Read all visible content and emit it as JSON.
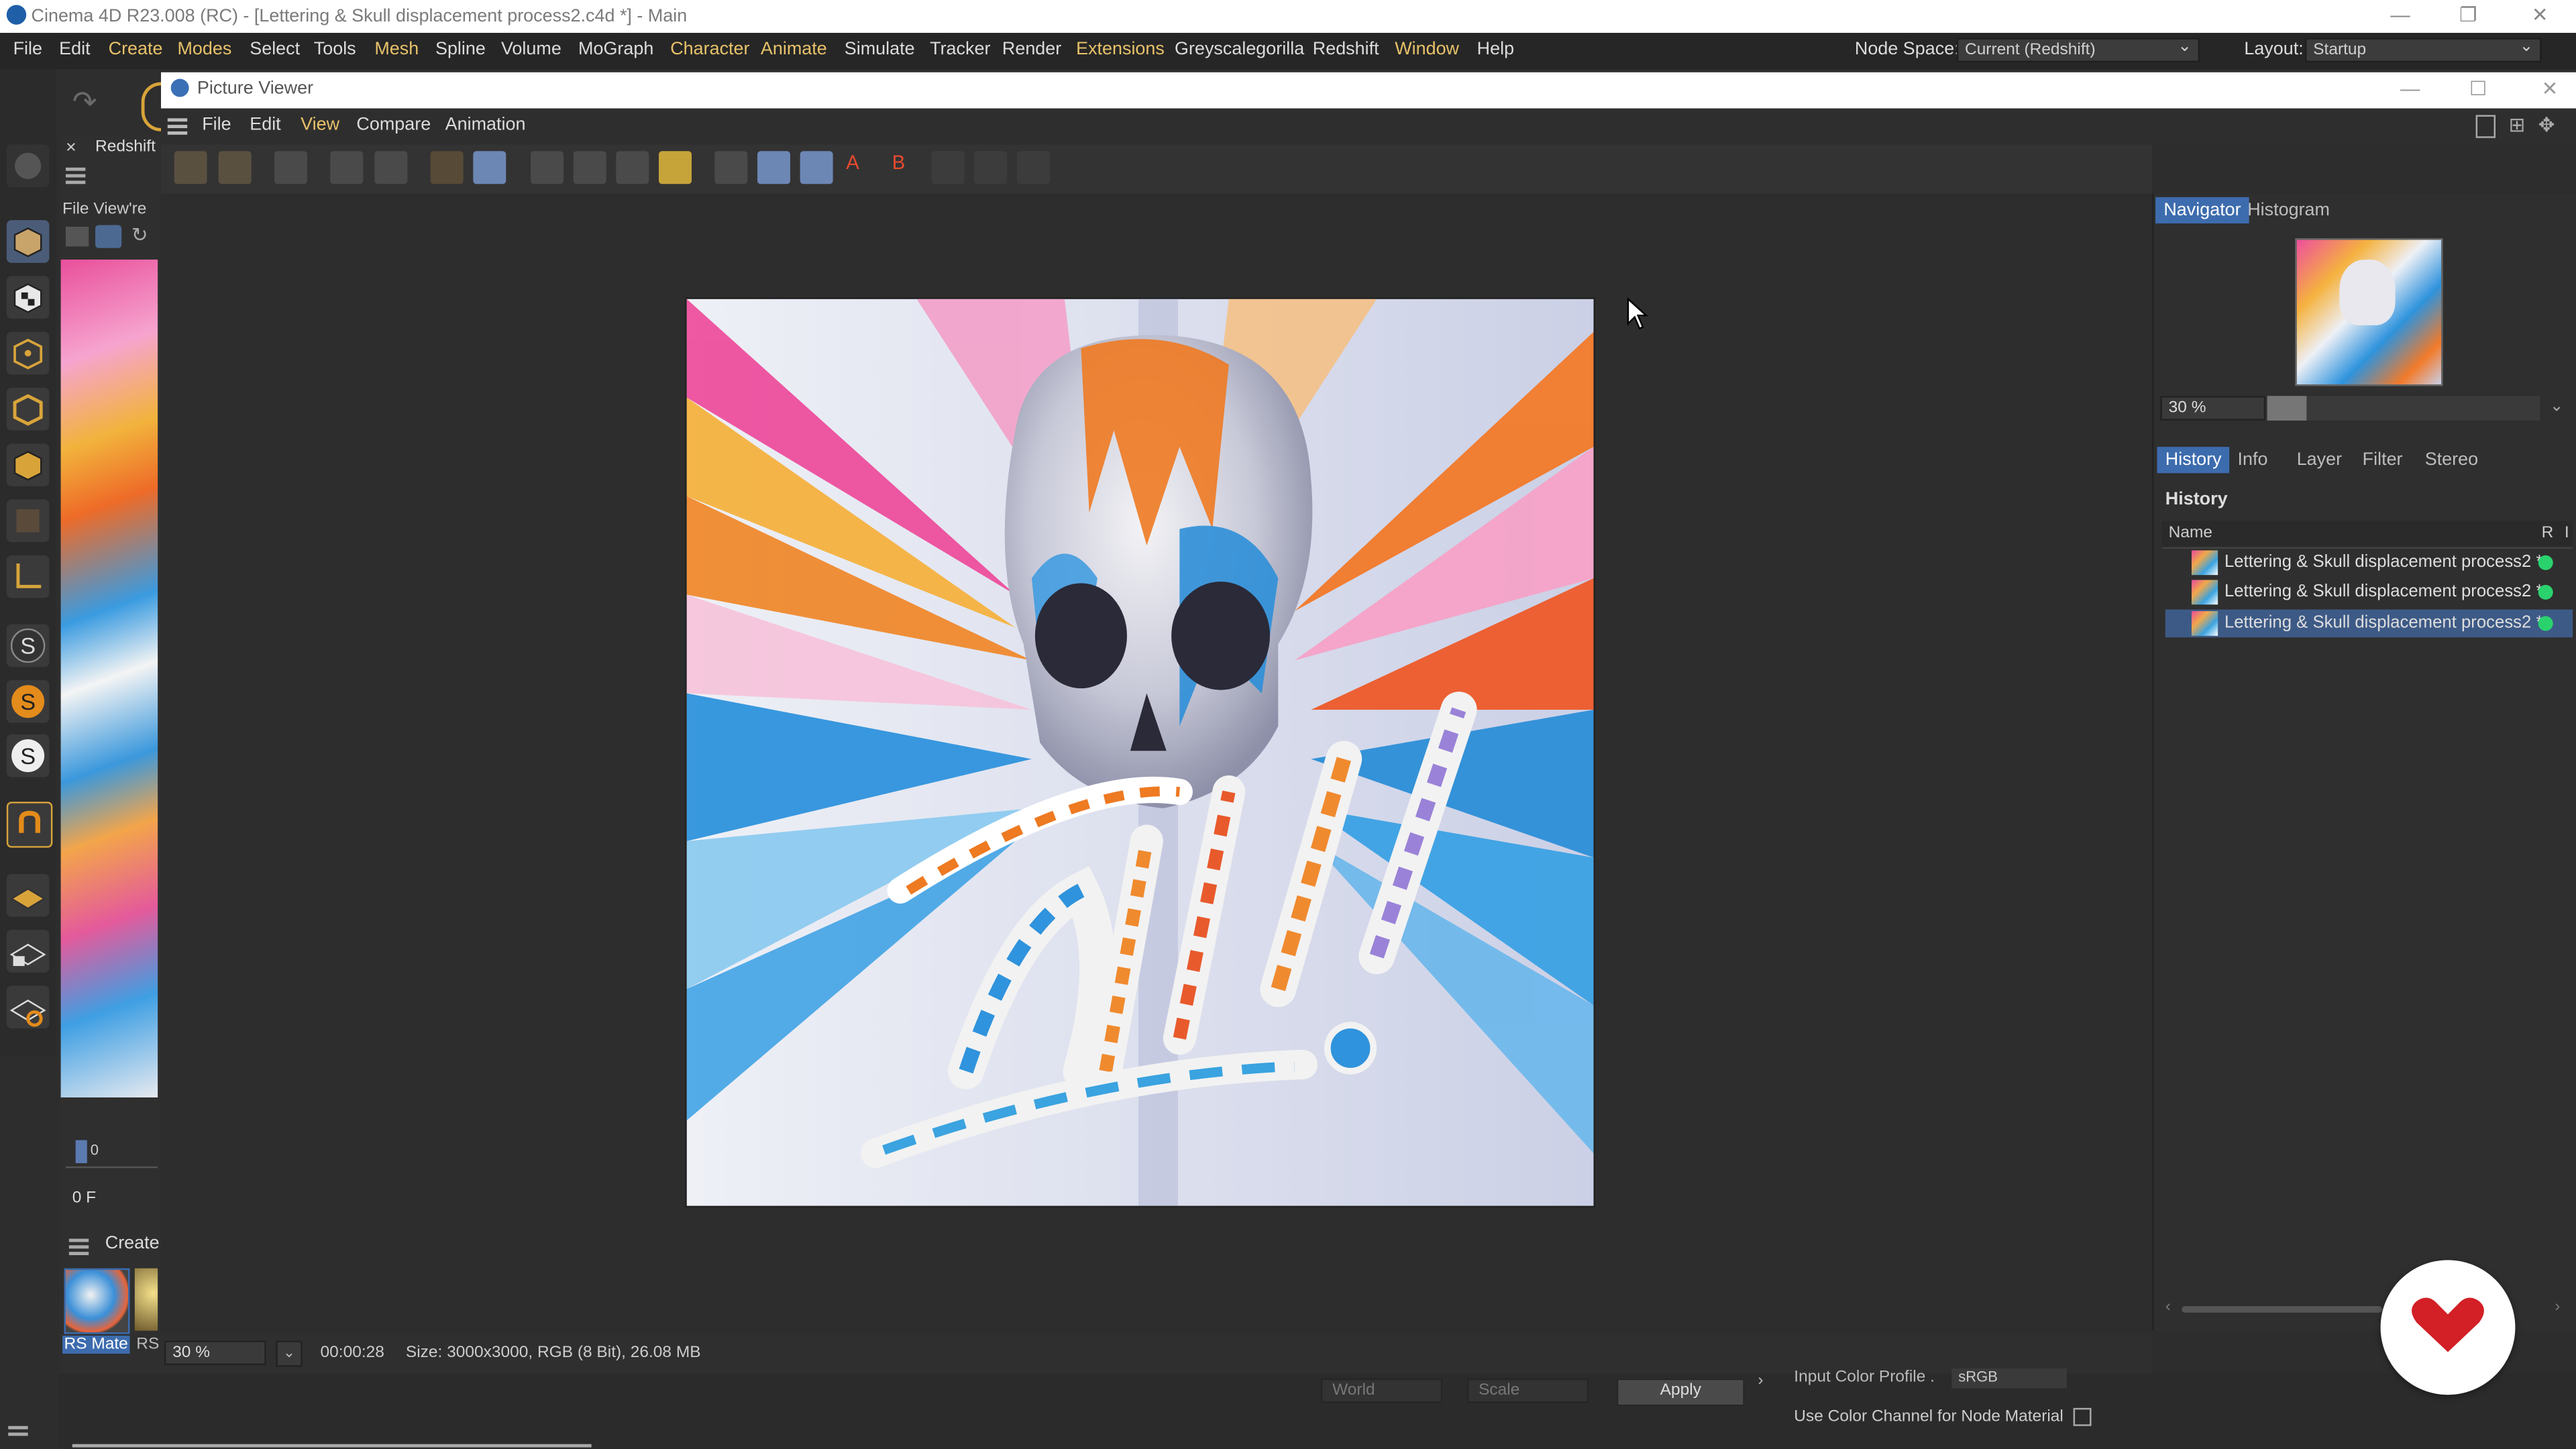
{
  "window": {
    "title": "Cinema 4D R23.008 (RC) - [Lettering & Skull displacement process2.c4d *] - Main",
    "minimize": "—",
    "restore": "❐",
    "close": "✕"
  },
  "menubar": {
    "items": [
      "File",
      "Edit",
      "Create",
      "Modes",
      "Select",
      "Tools",
      "Mesh",
      "Spline",
      "Volume",
      "MoGraph",
      "Character",
      "Animate",
      "Simulate",
      "Tracker",
      "Render",
      "Extensions",
      "Greyscalegorilla",
      "Redshift",
      "Window",
      "Help"
    ],
    "node_space_label": "Node Space:",
    "node_space_value": "Current (Redshift)",
    "layout_label": "Layout:",
    "layout_value": "Startup"
  },
  "left_panel": {
    "redshift_tab": "Redshift",
    "file_view": "File View're",
    "frame_value": "0",
    "frame_field": "0 F",
    "create_label": "Create",
    "material_label": "RS Mate",
    "material_label2": "RS"
  },
  "picture_viewer": {
    "title": "Picture Viewer",
    "menu": [
      "File",
      "Edit",
      "View",
      "Compare",
      "Animation"
    ],
    "zoom": "30 %",
    "time": "00:00:28",
    "size_info": "Size: 3000x3000, RGB (8 Bit), 26.08 MB"
  },
  "navigator": {
    "tabs": [
      "Navigator",
      "Histogram"
    ],
    "zoom": "30 %"
  },
  "history_panel": {
    "tabs": [
      "History",
      "Info",
      "Layer",
      "Filter",
      "Stereo"
    ],
    "heading": "History",
    "col_name": "Name",
    "col_r": "R",
    "col_f": "I",
    "rows": [
      {
        "label": "Lettering & Skull displacement process2 *"
      },
      {
        "label": "Lettering & Skull displacement process2 *"
      },
      {
        "label": "Lettering & Skull displacement process2 *"
      }
    ]
  },
  "bottom_bar": {
    "world": "World",
    "scale": "Scale",
    "apply": "Apply",
    "input_profile_label": "Input Color Profile .",
    "input_profile_value": "sRGB",
    "use_color_channel": "Use Color Channel for Node Material"
  },
  "colors": {
    "accent_blue": "#3d6cae",
    "menu_highlight": "#e8c26a",
    "status_green": "#2ad26e",
    "brand_red": "#d31f26"
  }
}
